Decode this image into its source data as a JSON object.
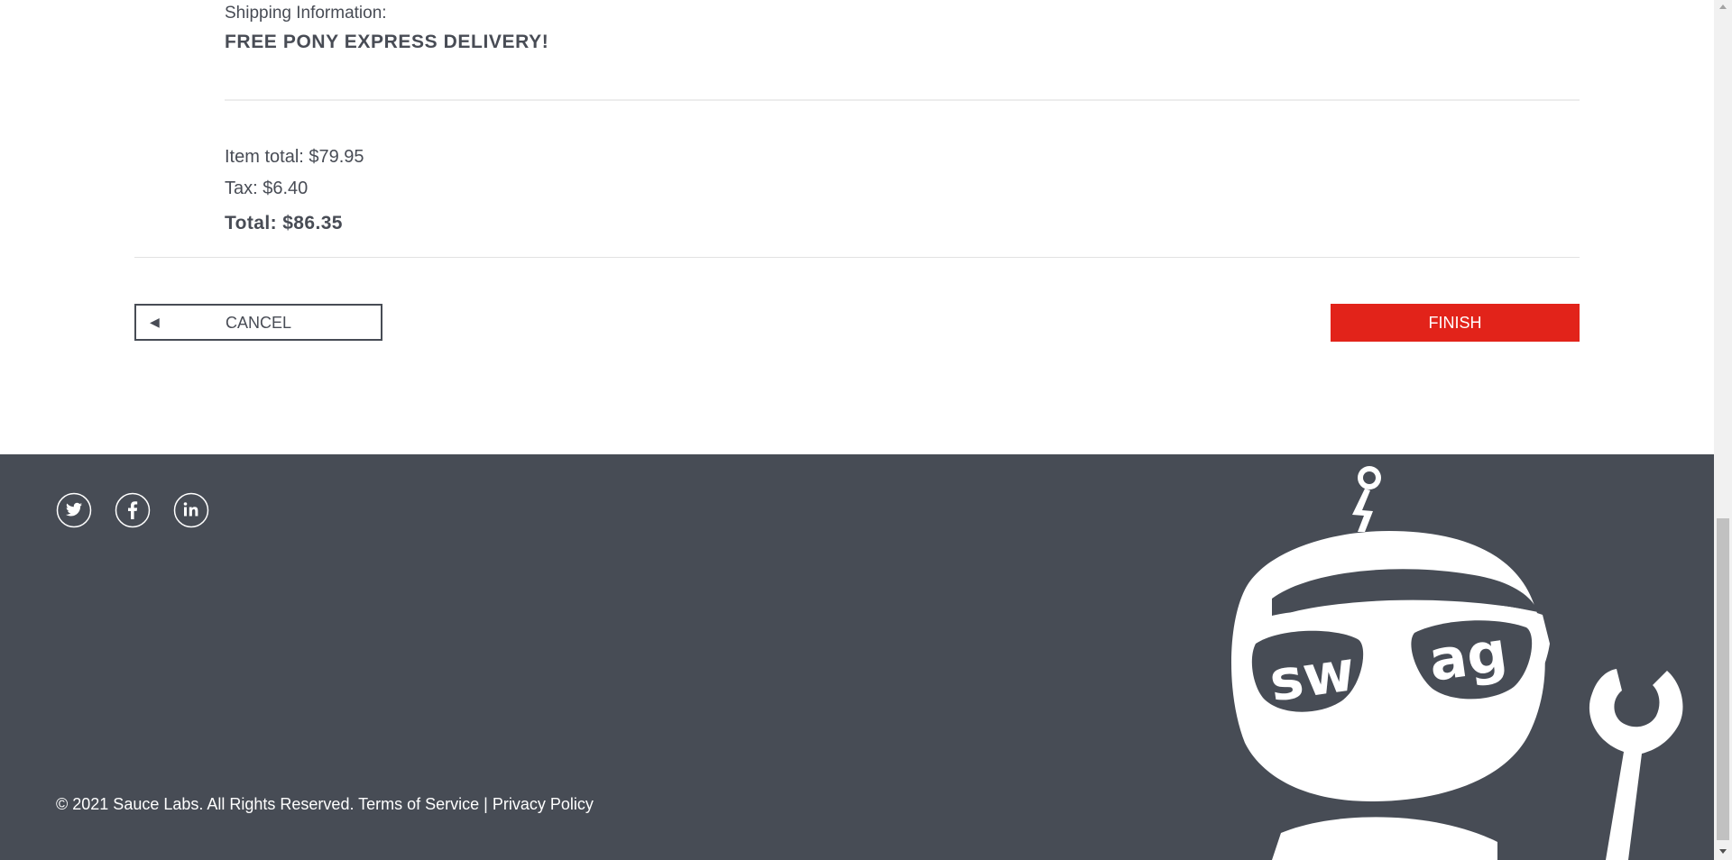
{
  "summary": {
    "shipping_label": "Shipping Information:",
    "shipping_value": "FREE PONY EXPRESS DELIVERY!",
    "item_total": "Item total: $79.95",
    "tax": "Tax: $6.40",
    "total": "Total: $86.35"
  },
  "actions": {
    "cancel_label": "CANCEL",
    "cancel_icon": "◀",
    "finish_label": "FINISH"
  },
  "footer": {
    "social": [
      {
        "name": "twitter-icon"
      },
      {
        "name": "facebook-icon"
      },
      {
        "name": "linkedin-icon"
      }
    ],
    "copyright": "© 2021 Sauce Labs. All Rights Reserved. Terms of Service | Privacy Policy",
    "mascot_text": "swag"
  },
  "colors": {
    "accent": "#e2231a",
    "footer_bg": "#474c55",
    "text": "#484c55"
  }
}
